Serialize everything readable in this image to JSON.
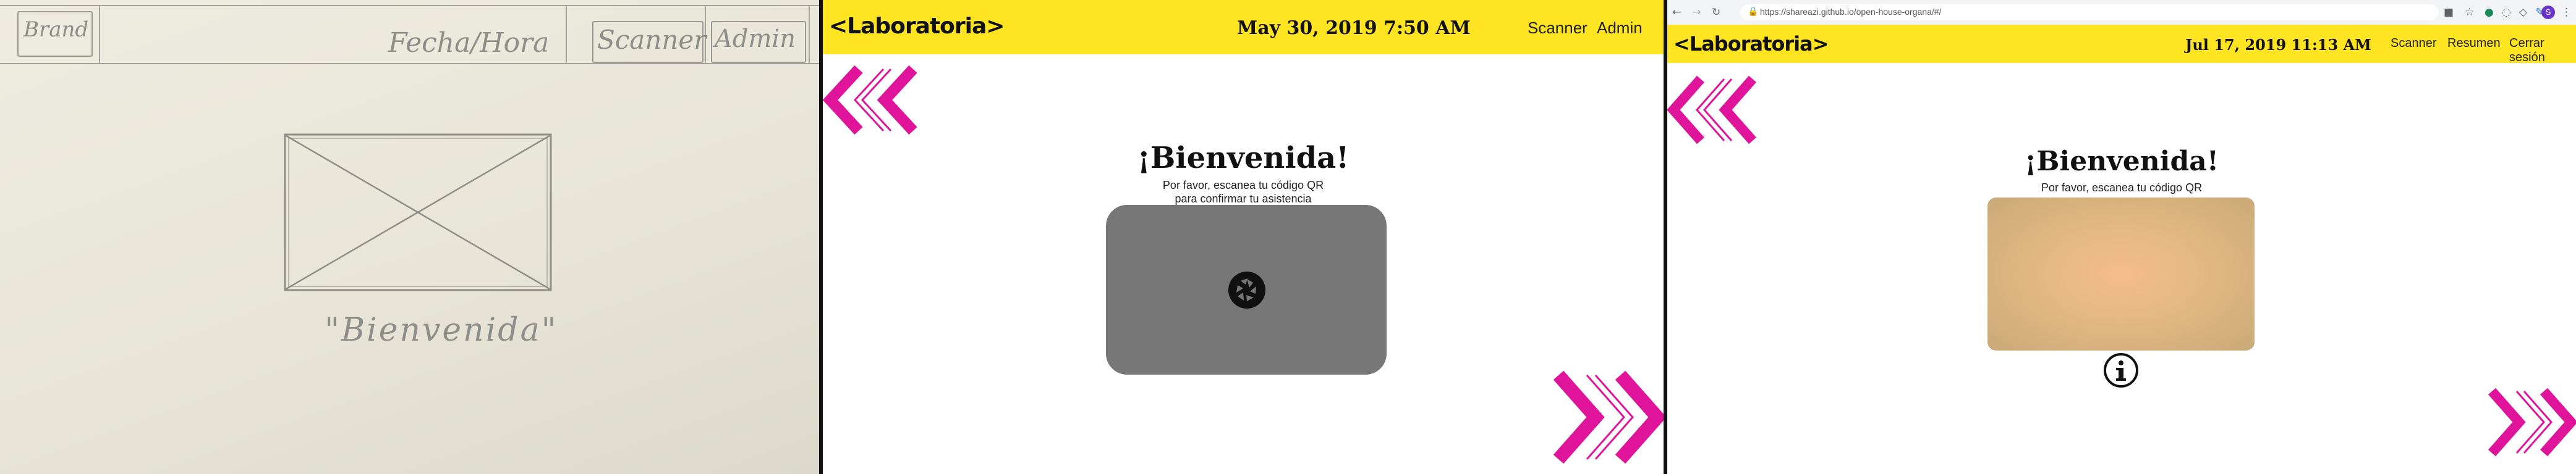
{
  "sketch": {
    "brand": "Brand",
    "datetime": "Fecha/Hora",
    "scanner": "Scanner",
    "admin": "Admin",
    "welcome": "\"Bienvenida\""
  },
  "app1": {
    "brand": "<Laboratoria>",
    "datetime": "May 30, 2019 7:50 AM",
    "nav": [
      "Scanner",
      "Admin"
    ],
    "welcome": "¡Bienvenida!",
    "subtitle_line1": "Por favor, escanea tu código QR",
    "subtitle_line2": "para confirmar tu asistencia",
    "camera_icon": "camera-shutter-icon"
  },
  "app2": {
    "url": "https://shareazi.github.io/open-house-organa/#/",
    "brand": "<Laboratoria>",
    "datetime": "Jul 17, 2019 11:13 AM",
    "nav": [
      "Scanner",
      "Resumen",
      "Cerrar sesión"
    ],
    "welcome": "¡Bienvenida!",
    "subtitle": "Por favor, escanea tu código QR",
    "info_icon": "info-icon",
    "profile_initial": "S"
  },
  "colors": {
    "yellow": "#ffe521",
    "magenta": "#e0139b",
    "camera_gray": "#777777"
  }
}
